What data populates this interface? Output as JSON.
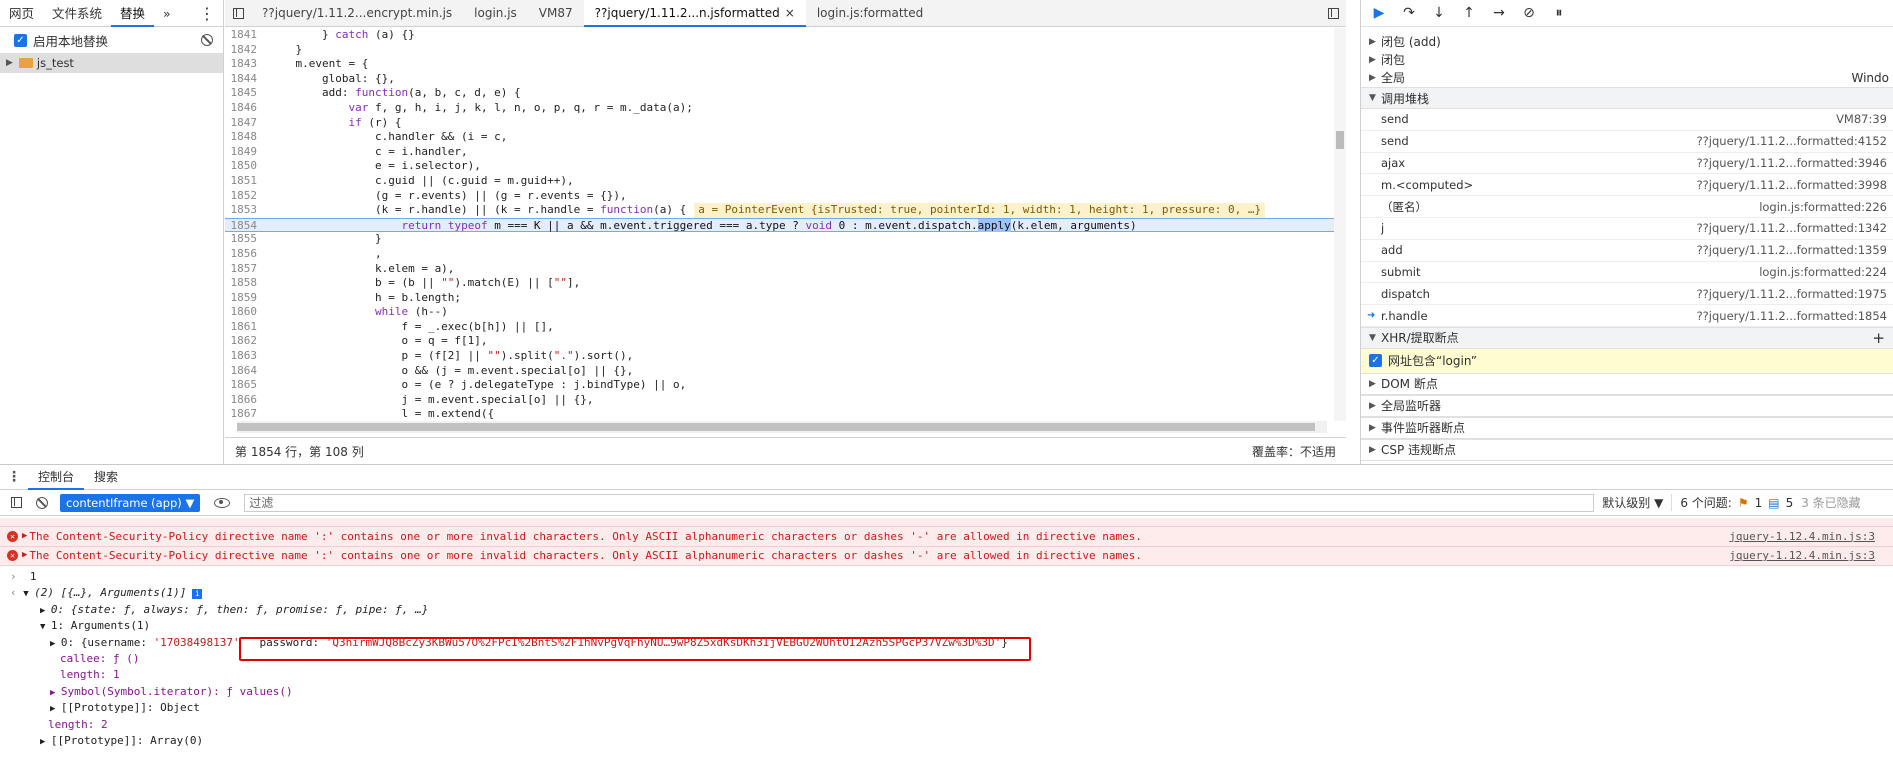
{
  "left_panel": {
    "tabs": [
      "网页",
      "文件系统",
      "替换"
    ],
    "more_label": "»",
    "enable_label": "启用本地替换",
    "folder": "js_test"
  },
  "editor": {
    "tabs": [
      {
        "label": "??jquery/1.11.2...encrypt.min.js"
      },
      {
        "label": "login.js"
      },
      {
        "label": "VM87"
      },
      {
        "label": "??jquery/1.11.2...n.jsformatted",
        "close": "×"
      },
      {
        "label": "login.js:formatted"
      }
    ],
    "lines": [
      {
        "n": "1841",
        "t": "        } catch (a) {}"
      },
      {
        "n": "1842",
        "t": "    }"
      },
      {
        "n": "1843",
        "t": "    m.event = {"
      },
      {
        "n": "1844",
        "t": "        global: {},"
      },
      {
        "n": "1845",
        "t": "        add: function(a, b, c, d, e) {"
      },
      {
        "n": "1846",
        "t": "            var f, g, h, i, j, k, l, n, o, p, q, r = m._data(a);"
      },
      {
        "n": "1847",
        "t": "            if (r) {"
      },
      {
        "n": "1848",
        "t": "                c.handler && (i = c,"
      },
      {
        "n": "1849",
        "t": "                c = i.handler,"
      },
      {
        "n": "1850",
        "t": "                e = i.selector),"
      },
      {
        "n": "1851",
        "t": "                c.guid || (c.guid = m.guid++),"
      },
      {
        "n": "1852",
        "t": "                (g = r.events) || (g = r.events = {}),"
      },
      {
        "n": "1853",
        "t": "                (k = r.handle) || (k = r.handle = function(a) {",
        "inline": "a = PointerEvent {isTrusted: true, pointerId: 1, width: 1, height: 1, pressure: 0, …}"
      },
      {
        "n": "1854",
        "t": "                    return typeof m === K || a && m.event.triggered === a.type ? void 0 : m.event.dispatch.apply(k.elem, arguments)"
      },
      {
        "n": "1855",
        "t": "                }"
      },
      {
        "n": "1856",
        "t": "                ,"
      },
      {
        "n": "1857",
        "t": "                k.elem = a),"
      },
      {
        "n": "1858",
        "t": "                b = (b || \"\").match(E) || [\"\"],"
      },
      {
        "n": "1859",
        "t": "                h = b.length;"
      },
      {
        "n": "1860",
        "t": "                while (h--)"
      },
      {
        "n": "1861",
        "t": "                    f = _.exec(b[h]) || [],"
      },
      {
        "n": "1862",
        "t": "                    o = q = f[1],"
      },
      {
        "n": "1863",
        "t": "                    p = (f[2] || \"\").split(\".\").sort(),"
      },
      {
        "n": "1864",
        "t": "                    o && (j = m.event.special[o] || {},"
      },
      {
        "n": "1865",
        "t": "                    o = (e ? j.delegateType : j.bindType) || o,"
      },
      {
        "n": "1866",
        "t": "                    j = m.event.special[o] || {},"
      },
      {
        "n": "1867",
        "t": "                    l = m.extend({"
      }
    ],
    "status": "第 1854 行，第 108 列",
    "coverage": "覆盖率：不适用"
  },
  "debugger": {
    "scope_items": [
      {
        "label": "闭包 (add)"
      },
      {
        "label": "闭包"
      },
      {
        "label": "全局",
        "value": "Windo"
      }
    ],
    "call_stack_title": "调用堆栈",
    "call_stack": [
      {
        "fn": "send",
        "loc": "VM87:39"
      },
      {
        "fn": "send",
        "loc": "??jquery/1.11.2...formatted:4152"
      },
      {
        "fn": "ajax",
        "loc": "??jquery/1.11.2...formatted:3946"
      },
      {
        "fn": "m.<computed>",
        "loc": "??jquery/1.11.2...formatted:3998"
      },
      {
        "fn": "（匿名）",
        "loc": "login.js:formatted:226"
      },
      {
        "fn": "j",
        "loc": "??jquery/1.11.2...formatted:1342"
      },
      {
        "fn": "add",
        "loc": "??jquery/1.11.2...formatted:1359"
      },
      {
        "fn": "submit",
        "loc": "login.js:formatted:224"
      },
      {
        "fn": "dispatch",
        "loc": "??jquery/1.11.2...formatted:1975"
      },
      {
        "fn": "r.handle",
        "loc": "??jquery/1.11.2...formatted:1854",
        "current": true
      }
    ],
    "xhr_title": "XHR/提取断点",
    "xhr_item": "网址包含“login”",
    "sections": [
      "DOM 断点",
      "全局监听器",
      "事件监听器断点",
      "CSP 违规断点"
    ]
  },
  "drawer": {
    "tabs": [
      "控制台",
      "搜索"
    ],
    "context": "contentIframe (app) ▼",
    "filter_placeholder": "过滤",
    "level": "默认级别 ▼",
    "issues_label": "6 个问题:",
    "warn_count": "1",
    "info_count": "5",
    "hidden": "3 条已隐藏"
  },
  "console": {
    "errors": [
      {
        "text": "The Content-Security-Policy directive name ':' contains one or more invalid characters. Only ASCII alphanumeric characters or dashes '-' are allowed in directive names.",
        "src": "jquery-1.12.4.min.js:3"
      },
      {
        "text": "The Content-Security-Policy directive name ':' contains one or more invalid characters. Only ASCII alphanumeric characters or dashes '-' are allowed in directive names.",
        "src": "jquery-1.12.4.min.js:3"
      }
    ],
    "input": "1",
    "result_summary": "(2) [{…}, Arguments(1)]",
    "row0": "0: {state: ƒ, always: ƒ, then: ƒ, promise: ƒ, pipe: ƒ, …}",
    "row1": "1: Arguments(1)",
    "row1_0_prefix": "0: {username: ",
    "row1_0_user": "'17038498137'",
    "row1_0_pwlabel": "password: ",
    "row1_0_pw": "'Q3hirmWJQ8BcZy3KBWu57O%2FPcI%2BntS%2F1hNvPgVqFhyNU…9wP8Z5xdKsDKh3IjVEBGU2WUhtOI2Azh5SPGcP37VZw%3D%3D'",
    "row1_0_end": "}",
    "callee": "callee: ƒ ()",
    "length1": "length: 1",
    "iterator": "Symbol(Symbol.iterator): ƒ values()",
    "proto_obj": "[[Prototype]]: Object",
    "length2": "length: 2",
    "proto_arr": "[[Prototype]]: Array(0)"
  }
}
